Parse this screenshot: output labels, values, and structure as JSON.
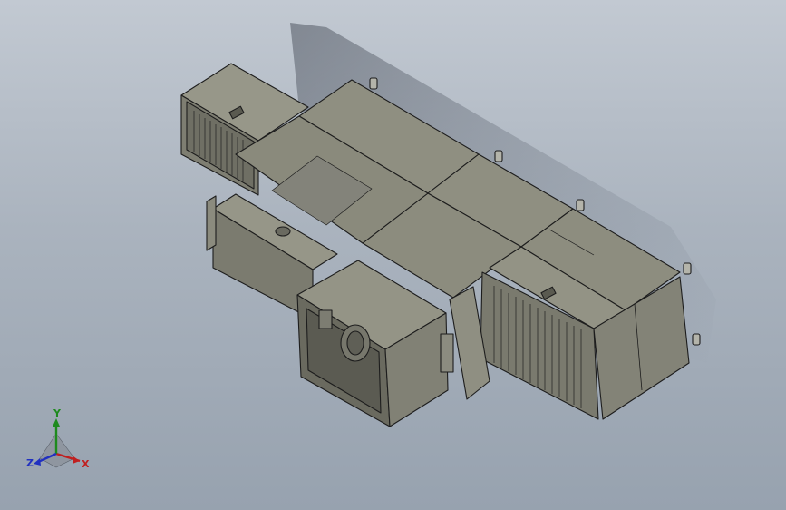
{
  "viewport": {
    "background_top": "#c2c9d2",
    "background_bottom": "#97a2af",
    "model_color": "#8a8a7d",
    "edge_color": "#1d1d1d"
  },
  "triad": {
    "x_label": "X",
    "y_label": "Y",
    "z_label": "Z",
    "x_color": "#c02020",
    "y_color": "#1e8a1e",
    "z_color": "#2030c0"
  }
}
